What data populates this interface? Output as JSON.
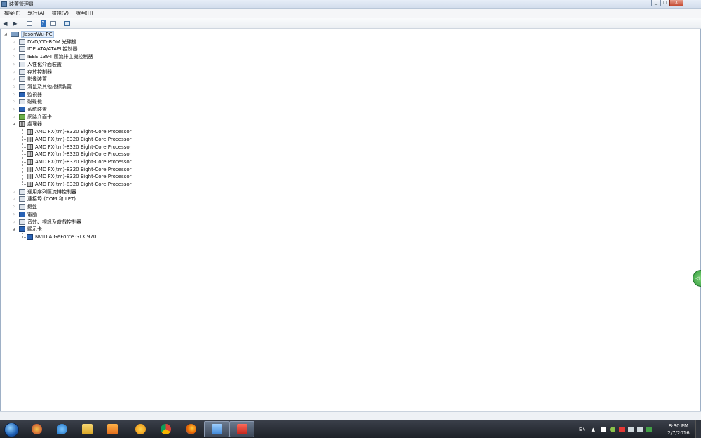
{
  "window": {
    "title": "裝置管理員"
  },
  "menu": [
    "檔案(F)",
    "執行(A)",
    "檢視(V)",
    "說明(H)"
  ],
  "tree": {
    "root": "JasonWu-PC",
    "categories": [
      "DVD/CD-ROM 光碟機",
      "IDE ATA/ATAPI 控制器",
      "IEEE 1394 匯流排主機控制器",
      "人性化介面裝置",
      "存放控制器",
      "影像裝置",
      "滑鼠及其他指標裝置",
      "監視器",
      "磁碟機",
      "系統裝置",
      "網路介面卡",
      "處理器",
      "通用序列匯流排控制器",
      "連接埠 (COM 和 LPT)",
      "鍵盤",
      "電腦",
      "音效、視訊及遊戲控制器",
      "顯示卡"
    ],
    "processors": [
      "AMD FX(tm)-8320 Eight-Core Processor",
      "AMD FX(tm)-8320 Eight-Core Processor",
      "AMD FX(tm)-8320 Eight-Core Processor",
      "AMD FX(tm)-8320 Eight-Core Processor",
      "AMD FX(tm)-8320 Eight-Core Processor",
      "AMD FX(tm)-8320 Eight-Core Processor",
      "AMD FX(tm)-8320 Eight-Core Processor",
      "AMD FX(tm)-8320 Eight-Core Processor"
    ],
    "display_adapters": [
      "NVIDIA GeForce GTX 970"
    ]
  },
  "taskbar": {
    "tray_lang": "EN",
    "time": "8:30 PM",
    "date": "2/7/2016"
  }
}
